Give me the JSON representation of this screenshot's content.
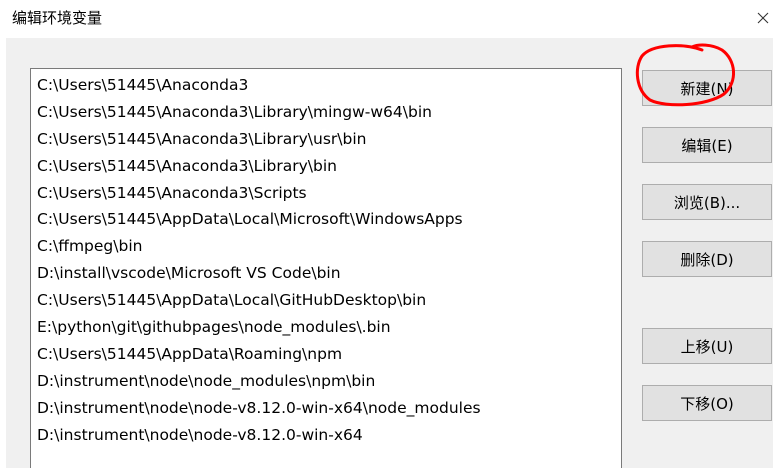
{
  "window": {
    "title": "编辑环境变量",
    "close_glyph": "✕"
  },
  "paths": [
    "C:\\Users\\51445\\Anaconda3",
    "C:\\Users\\51445\\Anaconda3\\Library\\mingw-w64\\bin",
    "C:\\Users\\51445\\Anaconda3\\Library\\usr\\bin",
    "C:\\Users\\51445\\Anaconda3\\Library\\bin",
    "C:\\Users\\51445\\Anaconda3\\Scripts",
    "C:\\Users\\51445\\AppData\\Local\\Microsoft\\WindowsApps",
    "C:\\ffmpeg\\bin",
    "D:\\install\\vscode\\Microsoft VS Code\\bin",
    "C:\\Users\\51445\\AppData\\Local\\GitHubDesktop\\bin",
    "E:\\python\\git\\githubpages\\node_modules\\.bin",
    "C:\\Users\\51445\\AppData\\Roaming\\npm",
    "D:\\instrument\\node\\node_modules\\npm\\bin",
    "D:\\instrument\\node\\node-v8.12.0-win-x64\\node_modules",
    "D:\\instrument\\node\\node-v8.12.0-win-x64"
  ],
  "buttons": {
    "new": "新建(N)",
    "edit": "编辑(E)",
    "browse": "浏览(B)...",
    "delete": "删除(D)",
    "move_up": "上移(U)",
    "move_down": "下移(O)"
  },
  "colors": {
    "annotation": "#ff0000"
  }
}
